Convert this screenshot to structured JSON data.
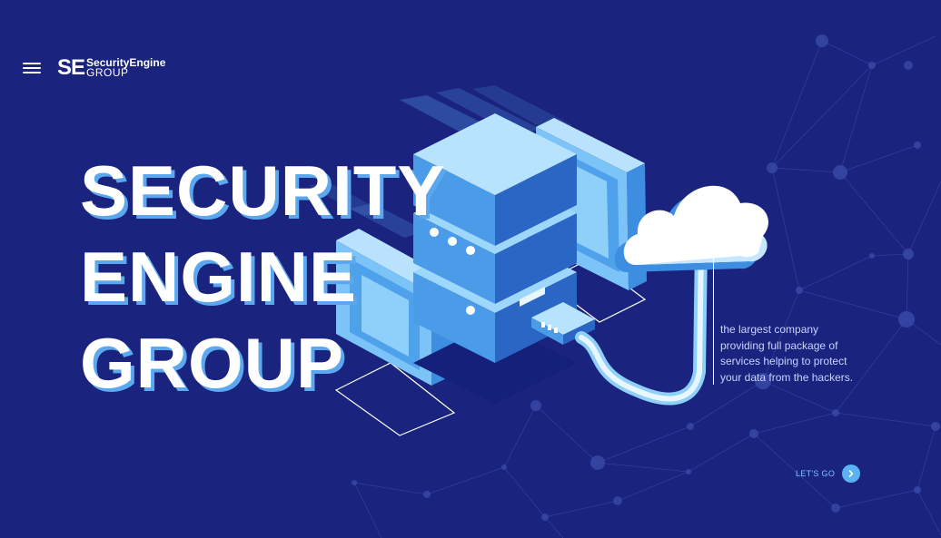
{
  "header": {
    "logo_mark": "SE",
    "logo_line1": "SecurityEngine",
    "logo_line2": "GROUP"
  },
  "hero": {
    "title_lines": [
      "SECURITY",
      "ENGINE",
      "GROUP"
    ]
  },
  "description": {
    "lines": [
      "the largest company",
      "providing full package of",
      "services helping to protect",
      "your data from the hackers."
    ]
  },
  "cta": {
    "label": "LET'S GO"
  },
  "icons": {
    "menu": "hamburger-menu-icon",
    "cta_arrow": "chevron-right-icon"
  },
  "colors": {
    "background": "#1a237e",
    "accent": "#5ab2f2",
    "title_shadow": "#5ba8f0"
  }
}
